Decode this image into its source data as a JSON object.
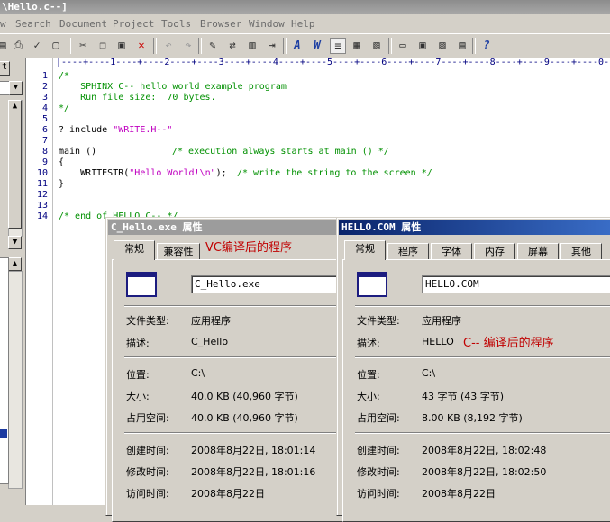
{
  "editor": {
    "title": "\\Hello.c--]",
    "menu": [
      "w",
      "Search",
      "Document",
      "Project",
      "Tools",
      "Browser",
      "Window",
      "Help"
    ],
    "left_tab_label": "t",
    "ruler": "|----+----1----+----2----+----3----+----4----+----5----+----6----+----7----+----8----+----9----+----0-",
    "line_numbers": [
      "1",
      "2",
      "3",
      "4",
      "5",
      "6",
      "7",
      "8",
      "9",
      "10",
      "11",
      "12",
      "13",
      "14"
    ],
    "code": {
      "l1": "/*",
      "l2": "    SPHINX C-- hello world example program",
      "l3": "    Run file size:  70 bytes.",
      "l4": "*/",
      "l6a": "? include ",
      "l6b": "\"WRITE.H--\"",
      "l8a": "main ()",
      "l8b": "/* execution always starts at main () */",
      "l9": "{",
      "l10a": "    WRITESTR(",
      "l10b": "\"Hello World!\\n\"",
      "l10c": ");",
      "l10d": "/* write the string to the screen */",
      "l11": "}",
      "l14": "/* end of HELLO.C-- */"
    }
  },
  "dialog_left": {
    "title": "C_Hello.exe 属性",
    "tabs": [
      "常规",
      "兼容性"
    ],
    "annotation": "VC编译后的程序",
    "filename": "C_Hello.exe",
    "fields": {
      "type_label": "文件类型:",
      "type_value": "应用程序",
      "desc_label": "描述:",
      "desc_value": "C_Hello",
      "loc_label": "位置:",
      "loc_value": "C:\\",
      "size_label": "大小:",
      "size_value": "40.0 KB (40,960 字节)",
      "disk_label": "占用空间:",
      "disk_value": "40.0 KB (40,960 字节)",
      "created_label": "创建时间:",
      "created_value": "2008年8月22日, 18:01:14",
      "modified_label": "修改时间:",
      "modified_value": "2008年8月22日, 18:01:16",
      "accessed_label": "访问时间:",
      "accessed_value": "2008年8月22日"
    }
  },
  "dialog_right": {
    "title": "HELLO.COM 属性",
    "tabs": [
      "常规",
      "程序",
      "字体",
      "内存",
      "屏幕",
      "其他"
    ],
    "annotation": "C-- 编译后的程序",
    "filename": "HELLO.COM",
    "fields": {
      "type_label": "文件类型:",
      "type_value": "应用程序",
      "desc_label": "描述:",
      "desc_value": "HELLO",
      "loc_label": "位置:",
      "loc_value": "C:\\",
      "size_label": "大小:",
      "size_value": "43 字节 (43 字节)",
      "disk_label": "占用空间:",
      "disk_value": "8.00 KB (8,192 字节)",
      "created_label": "创建时间:",
      "created_value": "2008年8月22日, 18:02:48",
      "modified_label": "修改时间:",
      "modified_value": "2008年8月22日, 18:02:50",
      "accessed_label": "访问时间:",
      "accessed_value": "2008年8月22日"
    }
  },
  "colors": {
    "active_title": "#1c4a9c",
    "inactive_title": "#9c9c9c",
    "annotation": "#c00000",
    "comment": "#009000",
    "string": "#c000c0"
  }
}
